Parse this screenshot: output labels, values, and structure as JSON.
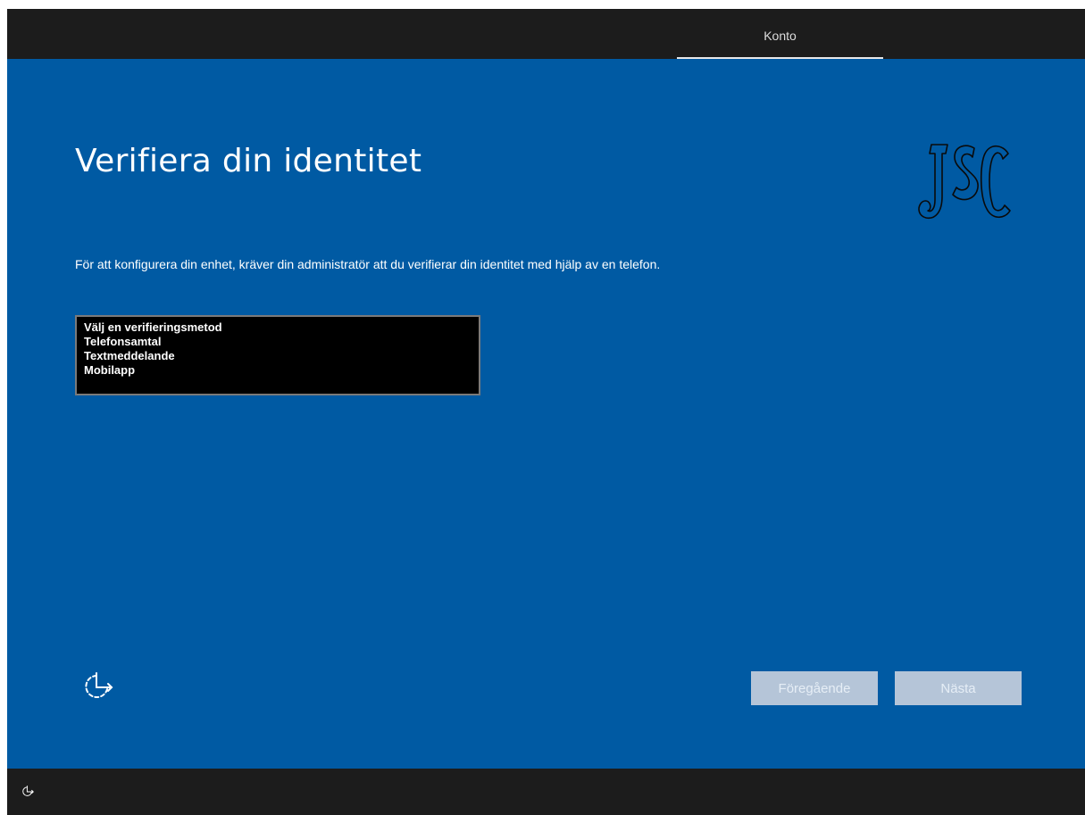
{
  "header": {
    "tab_label": "Konto"
  },
  "page": {
    "title": "Verifiera din identitet",
    "description": "För att konfigurera din enhet, kräver din administratör att du verifierar din identitet med hjälp av en telefon.",
    "logo_text": "JSC"
  },
  "verification_methods": {
    "options": [
      "Välj en verifieringsmetod",
      "Telefonsamtal",
      "Textmeddelande",
      "Mobilapp"
    ]
  },
  "buttons": {
    "previous_label": "Föregående",
    "next_label": "Nästa"
  },
  "icons": {
    "ease_of_access": "ease-of-access-icon"
  },
  "colors": {
    "background": "#005aa3",
    "top_bar": "#1c1c1c",
    "list_background": "#000000",
    "disabled_button": "#b5c5d8"
  }
}
